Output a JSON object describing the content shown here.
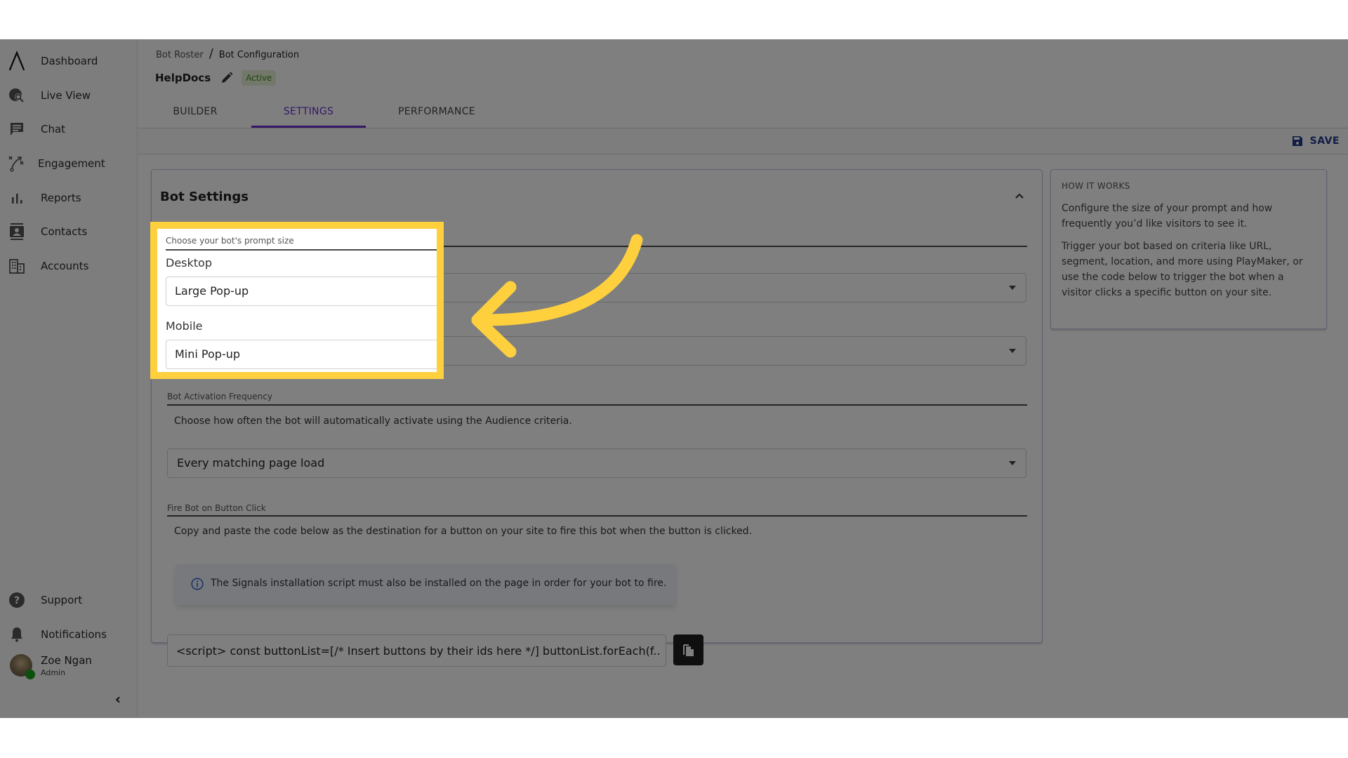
{
  "sidebar": {
    "items": [
      {
        "label": "Dashboard",
        "icon": "logo-caret-icon"
      },
      {
        "label": "Live View",
        "icon": "globe-search-icon"
      },
      {
        "label": "Chat",
        "icon": "chat-icon"
      },
      {
        "label": "Engagement",
        "icon": "playbook-icon"
      },
      {
        "label": "Reports",
        "icon": "bar-chart-icon"
      },
      {
        "label": "Contacts",
        "icon": "contact-card-icon"
      },
      {
        "label": "Accounts",
        "icon": "building-icon"
      }
    ],
    "bottom": [
      {
        "label": "Support",
        "icon": "help-icon"
      },
      {
        "label": "Notifications",
        "icon": "bell-icon"
      }
    ],
    "user": {
      "name": "Zoe Ngan",
      "role": "Admin",
      "status_color": "#19a01e"
    },
    "collapse_glyph": "‹"
  },
  "header": {
    "breadcrumb": [
      "Bot Roster",
      "Bot Configuration"
    ],
    "breadcrumb_sep": "/",
    "bot_name": "HelpDocs",
    "status_badge": "Active",
    "tabs": [
      {
        "label": "BUILDER",
        "active": false
      },
      {
        "label": "SETTINGS",
        "active": true
      },
      {
        "label": "PERFORMANCE",
        "active": false
      }
    ],
    "save_label": "SAVE",
    "accent_color": "#6a2fd0"
  },
  "card": {
    "title": "Bot Settings",
    "prompt_size": {
      "section_label": "Choose your bot's prompt size",
      "desktop_label": "Desktop",
      "desktop_value": "Large Pop-up",
      "mobile_label": "Mobile",
      "mobile_value": "Mini Pop-up"
    },
    "frequency": {
      "section_label": "Bot Activation Frequency",
      "description": "Choose how often the bot will automatically activate using the Audience criteria.",
      "value": "Every matching page load"
    },
    "fire_on_click": {
      "section_label": "Fire Bot on Button Click",
      "description": "Copy and paste the code below as the destination for a button on your site to fire this bot when the button is clicked.",
      "info": "The Signals installation script must also be installed on the page in order for your bot to fire.",
      "code": "<script> const buttonList=[/* Insert buttons by their ids here */] buttonList.forEach(f..."
    }
  },
  "how_it_works": {
    "heading": "HOW IT WORKS",
    "paragraphs": [
      "Configure the size of your prompt and how frequently you’d like visitors to see it.",
      "Trigger your bot based on criteria like URL, segment, location, and more using PlayMaker, or use the code below to trigger the bot when a visitor clicks a specific button on your site."
    ]
  },
  "annotation": {
    "highlight_color": "#ffd03e"
  }
}
